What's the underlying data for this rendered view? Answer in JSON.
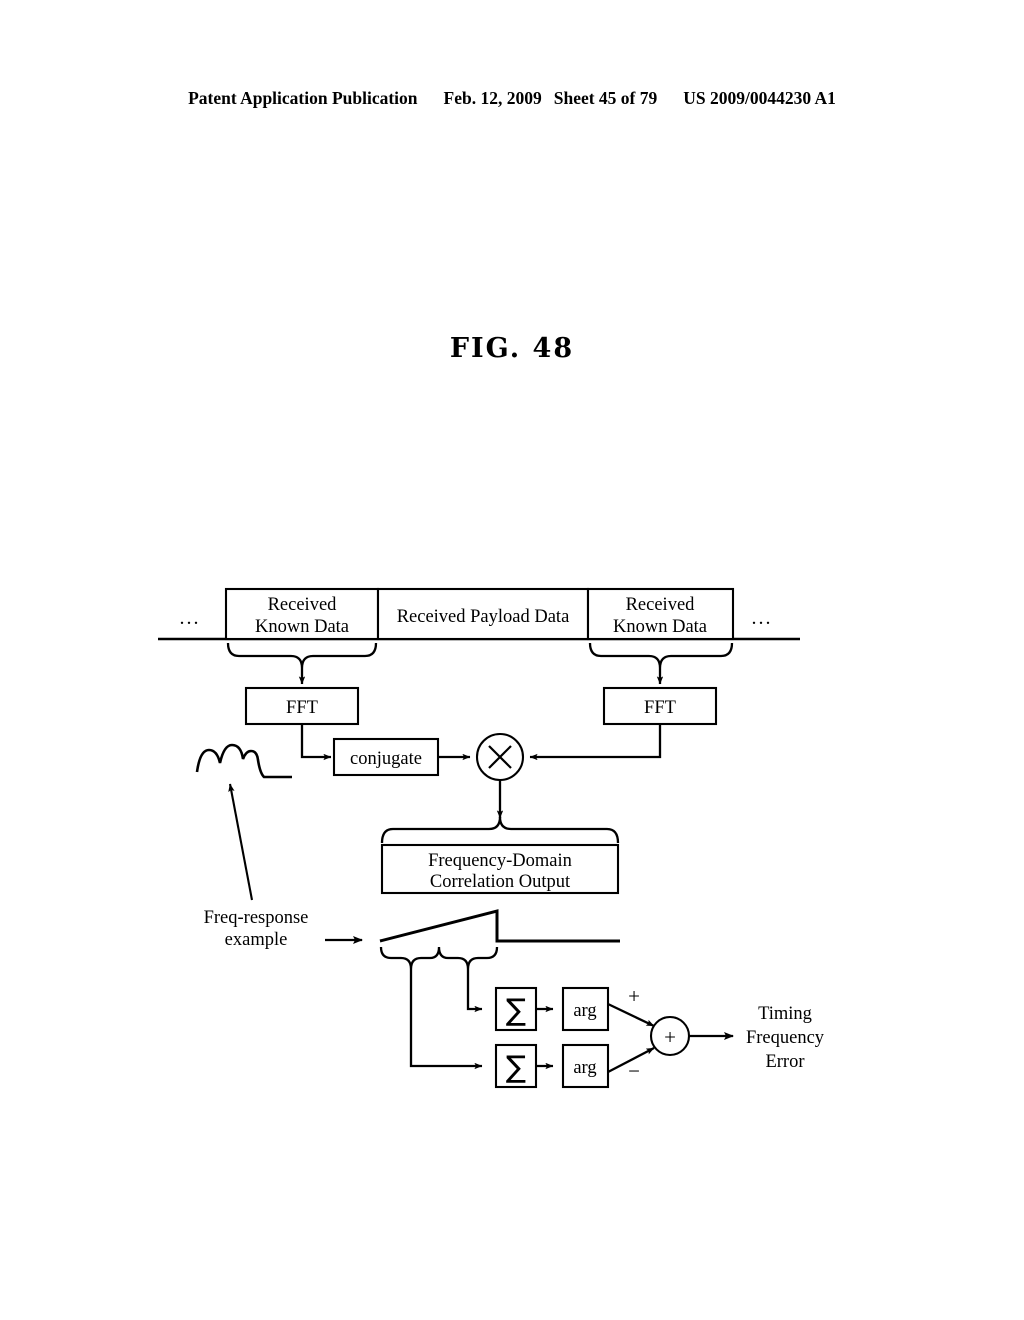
{
  "header": {
    "publication": "Patent Application Publication",
    "date": "Feb. 12, 2009",
    "sheet": "Sheet 45 of 79",
    "patent_number": "US 2009/0044230 A1"
  },
  "figure": {
    "title": "FIG. 48"
  },
  "frame": {
    "ellipsis_left": "...",
    "ellipsis_right": "...",
    "blocks": [
      {
        "id": "known-left",
        "label_line1": "Received",
        "label_line2": "Known Data"
      },
      {
        "id": "payload",
        "label_line1": "Received Payload Data",
        "label_line2": ""
      },
      {
        "id": "known-right",
        "label_line1": "Received",
        "label_line2": "Known Data"
      }
    ]
  },
  "diagram": {
    "fft_left": "FFT",
    "fft_right": "FFT",
    "conjugate": "conjugate",
    "multiplier": "×",
    "correlation_output_line1": "Frequency-Domain",
    "correlation_output_line2": "Correlation Output",
    "freq_response_label_line1": "Freq-response",
    "freq_response_label_line2": "example",
    "sum_upper": "∑",
    "sum_lower": "∑",
    "arg_upper": "arg",
    "arg_lower": "arg",
    "adder": "+",
    "sign_plus": "+",
    "sign_minus": "−",
    "output_line1": "Timing",
    "output_line2": "Frequency",
    "output_line3": "Error"
  },
  "colors": {
    "ink": "#000000",
    "paper": "#ffffff"
  }
}
